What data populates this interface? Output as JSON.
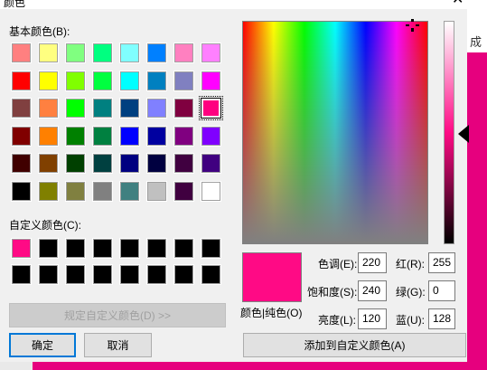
{
  "window": {
    "title": "颜色",
    "close_glyph": "✕"
  },
  "background": {
    "cut_text": "成"
  },
  "basic_colors": {
    "label": "基本颜色(B):",
    "swatches": [
      [
        "#ff8080",
        "#ffff80",
        "#80ff80",
        "#00ff80",
        "#80ffff",
        "#0080ff",
        "#ff80c0",
        "#ff80ff"
      ],
      [
        "#ff0000",
        "#ffff00",
        "#80ff00",
        "#00ff40",
        "#00ffff",
        "#0080c0",
        "#8080c0",
        "#ff00ff"
      ],
      [
        "#804040",
        "#ff8040",
        "#00ff00",
        "#008080",
        "#004080",
        "#8080ff",
        "#800040",
        "#ff0080"
      ],
      [
        "#800000",
        "#ff8000",
        "#008000",
        "#008040",
        "#0000ff",
        "#0000a0",
        "#800080",
        "#8000ff"
      ],
      [
        "#400000",
        "#804000",
        "#004000",
        "#004040",
        "#000080",
        "#000040",
        "#400040",
        "#400080"
      ],
      [
        "#000000",
        "#808000",
        "#808040",
        "#808080",
        "#408080",
        "#c0c0c0",
        "#400040",
        "#ffffff"
      ]
    ],
    "selected_color": "#ff0080"
  },
  "custom_colors": {
    "label": "自定义颜色(C):",
    "swatches": [
      "#ff0a85",
      "#000000",
      "#000000",
      "#000000",
      "#000000",
      "#000000",
      "#000000",
      "#000000",
      "#000000",
      "#000000",
      "#000000",
      "#000000",
      "#000000",
      "#000000",
      "#000000",
      "#000000"
    ]
  },
  "buttons": {
    "define_custom": "规定自定义颜色(D) >>",
    "ok": "确定",
    "cancel": "取消",
    "add_custom": "添加到自定义颜色(A)"
  },
  "preview": {
    "label": "颜色|纯色(O)",
    "color": "#ff0a85"
  },
  "hsl": {
    "hue_label": "色调(E):",
    "hue": "220",
    "sat_label": "饱和度(S):",
    "sat": "240",
    "lum_label": "亮度(L):",
    "lum": "120"
  },
  "rgb": {
    "red_label": "红(R):",
    "red": "255",
    "green_label": "绿(G):",
    "green": "0",
    "blue_label": "蓝(U):",
    "blue": "128"
  }
}
